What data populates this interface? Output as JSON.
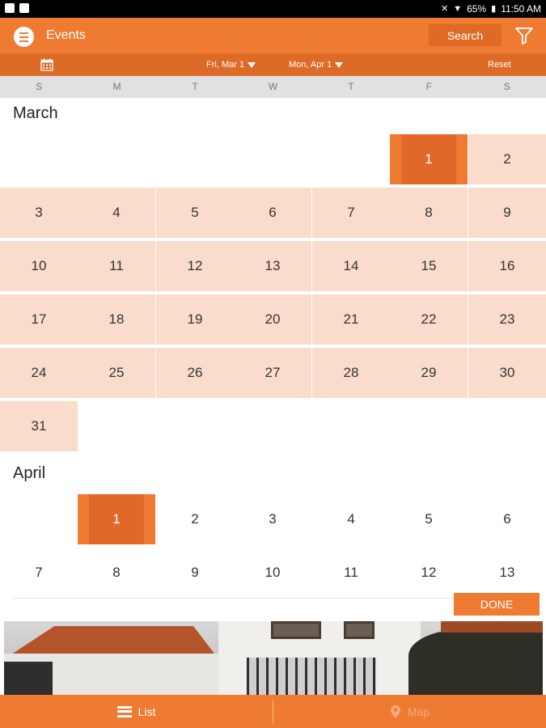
{
  "status": {
    "battery": "65%",
    "time": "11:50 AM"
  },
  "app_bar": {
    "title": "Events",
    "search_label": "Search"
  },
  "date_bar": {
    "from": "Fri, Mar 1",
    "to": "Mon, Apr 1",
    "reset": "Reset"
  },
  "weekdays": [
    "S",
    "M",
    "T",
    "W",
    "T",
    "F",
    "S"
  ],
  "calendar": {
    "months": [
      {
        "name": "March",
        "first_weekday": 5,
        "days": 31,
        "selected": [
          1
        ],
        "range_through": 31
      },
      {
        "name": "April",
        "first_weekday": 1,
        "days": 13,
        "selected": [
          1
        ],
        "range_through": 0
      }
    ]
  },
  "done_label": "DONE",
  "tabs": {
    "list": "List",
    "map": "Map"
  },
  "colors": {
    "primary": "#ef7b33",
    "dark": "#e2682a",
    "range": "#f9dccc"
  }
}
